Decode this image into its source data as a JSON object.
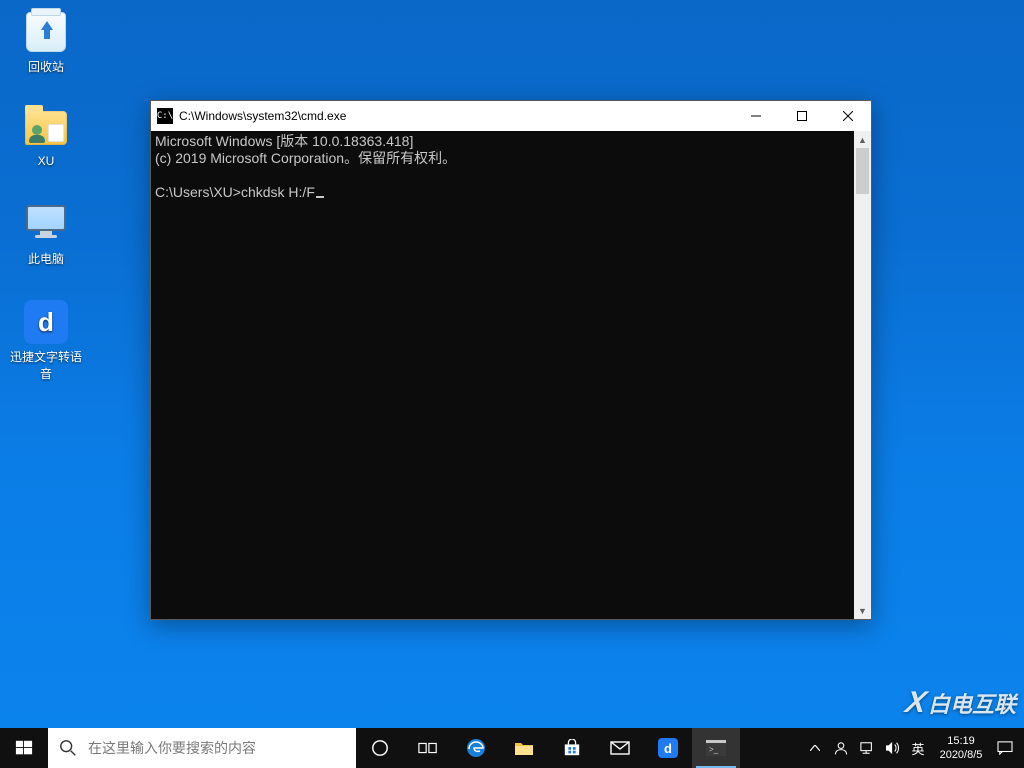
{
  "desktop": {
    "icons": [
      {
        "id": "recycle-bin",
        "label": "回收站"
      },
      {
        "id": "xu-folder",
        "label": "XU"
      },
      {
        "id": "this-pc",
        "label": "此电脑"
      },
      {
        "id": "xunjie-tts",
        "label": "迅捷文字转语\n音"
      }
    ]
  },
  "cmd": {
    "title": "C:\\Windows\\system32\\cmd.exe",
    "lines": [
      "Microsoft Windows [版本 10.0.18363.418]",
      "(c) 2019 Microsoft Corporation。保留所有权利。",
      ""
    ],
    "prompt": "C:\\Users\\XU>",
    "input": "chkdsk H:/F"
  },
  "taskbar": {
    "search_placeholder": "在这里输入你要搜索的内容",
    "ime": "英",
    "time": "15:19",
    "date": "2020/8/5"
  },
  "watermark": "白电互联"
}
